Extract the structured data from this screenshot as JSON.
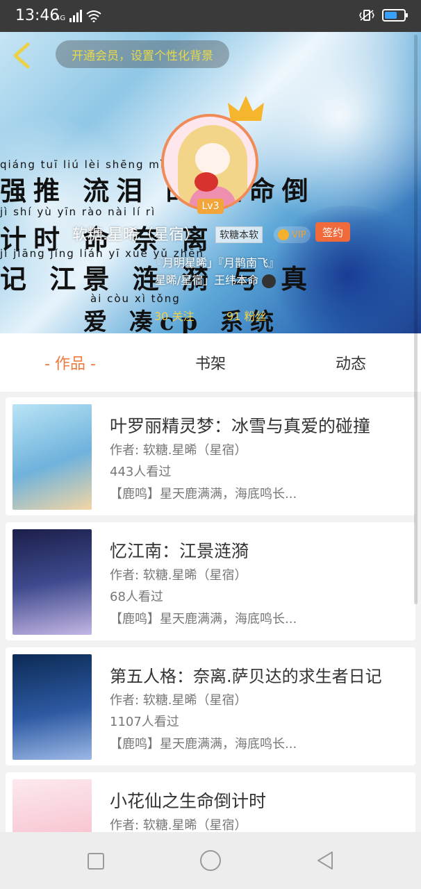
{
  "status_bar": {
    "time": "13:46",
    "network": "4G",
    "battery_level": 0.7
  },
  "header": {
    "back_icon": "chevron-left-icon",
    "vip_prompt": "开通会员，设置个性化背景",
    "banner_text_lines": [
      "强推 流泪 的 生命倒",
      "计时 命 奈 离",
      "记 江景 涟 漪 与 真",
      "爱 凑cp 系统"
    ],
    "banner_pinyin_lines": [
      "qiáng tuī liú lèi shēng mìng dǎo",
      "jì shí yù yīn rào nài lí rì",
      "jì jiāng jǐng lián yī xuě yǔ zhēn",
      "ài còu xì tǒng"
    ],
    "user": {
      "name": "软糖.星晞（星宿）",
      "level": "Lv3",
      "tag": "软糖本软",
      "vip_label": "VIP",
      "sign_label": "签约",
      "bio_line1": "『月明星晞」『月鹊南飞』",
      "bio_line2": "星晞/星宿」王纬本命",
      "follow_count": "30 关注",
      "fans_count": "91 粉丝"
    }
  },
  "tabs": [
    {
      "label": "- 作品 -",
      "active": true
    },
    {
      "label": "书架",
      "active": false
    },
    {
      "label": "动态",
      "active": false
    }
  ],
  "books": [
    {
      "title": "叶罗丽精灵梦：冰雪与真爱的碰撞",
      "author": "作者: 软糖.星晞（星宿）",
      "views": "443人看过",
      "desc": "【鹿鸣】星天鹿满满，海底鸣长..."
    },
    {
      "title": "忆江南：江景涟漪",
      "author": "作者: 软糖.星晞（星宿）",
      "views": "68人看过",
      "desc": "【鹿鸣】星天鹿满满，海底鸣长..."
    },
    {
      "title": "第五人格：奈离.萨贝达的求生者日记",
      "author": "作者: 软糖.星晞（星宿）",
      "views": "1107人看过",
      "desc": "【鹿鸣】星天鹿满满，海底鸣长..."
    },
    {
      "title": "小花仙之生命倒计时",
      "author": "作者: 软糖.星晞（星宿）",
      "views": "",
      "desc": ""
    }
  ],
  "nav_bar": {
    "icons": [
      "square-recent-apps-icon",
      "circle-home-icon",
      "triangle-back-icon"
    ]
  }
}
